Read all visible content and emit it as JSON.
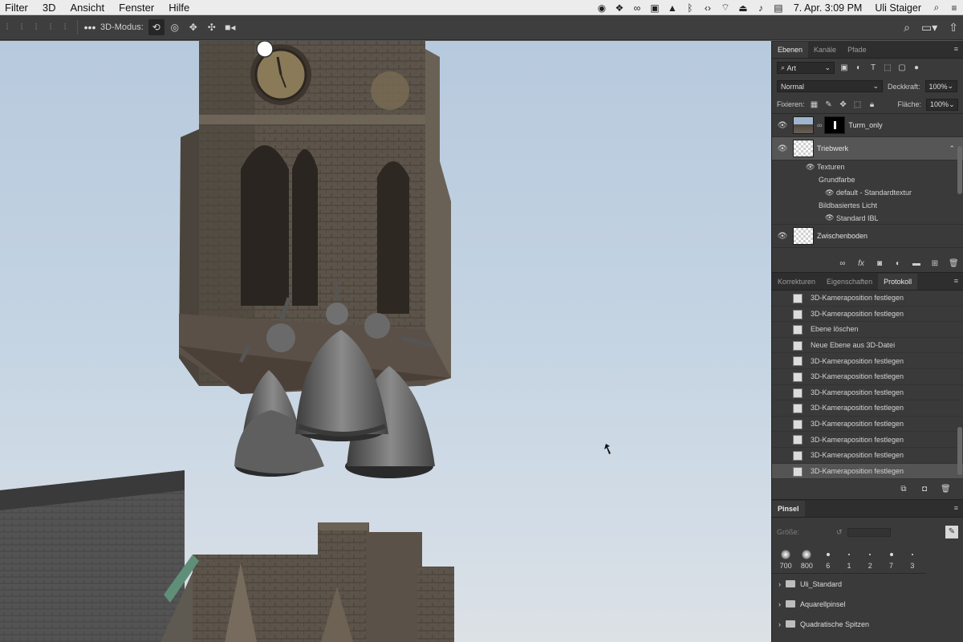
{
  "menubar": {
    "menus": [
      "Filter",
      "3D",
      "Ansicht",
      "Fenster",
      "Hilfe"
    ],
    "datetime": "7. Apr.  3:09 PM",
    "user": "Uli Staiger"
  },
  "options_bar": {
    "mode_label": "3D-Modus:"
  },
  "layers_panel": {
    "tabs": [
      "Ebenen",
      "Kanäle",
      "Pfade"
    ],
    "filter_kind": "Art",
    "blend_mode": "Normal",
    "opacity_label": "Deckkraft:",
    "opacity_value": "100%",
    "lock_label": "Fixieren:",
    "fill_label": "Fläche:",
    "fill_value": "100%",
    "layers": [
      {
        "name": "Turm_only"
      },
      {
        "name": "Triebwerk"
      },
      {
        "name": "Zwischenboden"
      }
    ],
    "sublayers": {
      "textures": "Texturen",
      "base_color": "Grundfarbe",
      "default_texture": "default - Standardtextur",
      "ibl": "Bildbasiertes Licht",
      "standard_ibl": "Standard IBL"
    }
  },
  "history_panel": {
    "tabs": [
      "Korrekturen",
      "Eigenschaften",
      "Protokoll"
    ],
    "items": [
      "3D-Kameraposition festlegen",
      "3D-Kameraposition festlegen",
      "Ebene löschen",
      "Neue Ebene aus 3D-Datei",
      "3D-Kameraposition festlegen",
      "3D-Kameraposition festlegen",
      "3D-Kameraposition festlegen",
      "3D-Kameraposition festlegen",
      "3D-Kameraposition festlegen",
      "3D-Kameraposition festlegen",
      "3D-Kameraposition festlegen",
      "3D-Kameraposition festlegen"
    ]
  },
  "brush_panel": {
    "title": "Pinsel",
    "size_label": "Größe:",
    "presets": [
      "700",
      "800",
      "6",
      "1",
      "2",
      "7",
      "3"
    ],
    "folders": [
      "Uli_Standard",
      "Aquarellpinsel",
      "Quadratische Spitzen"
    ]
  }
}
